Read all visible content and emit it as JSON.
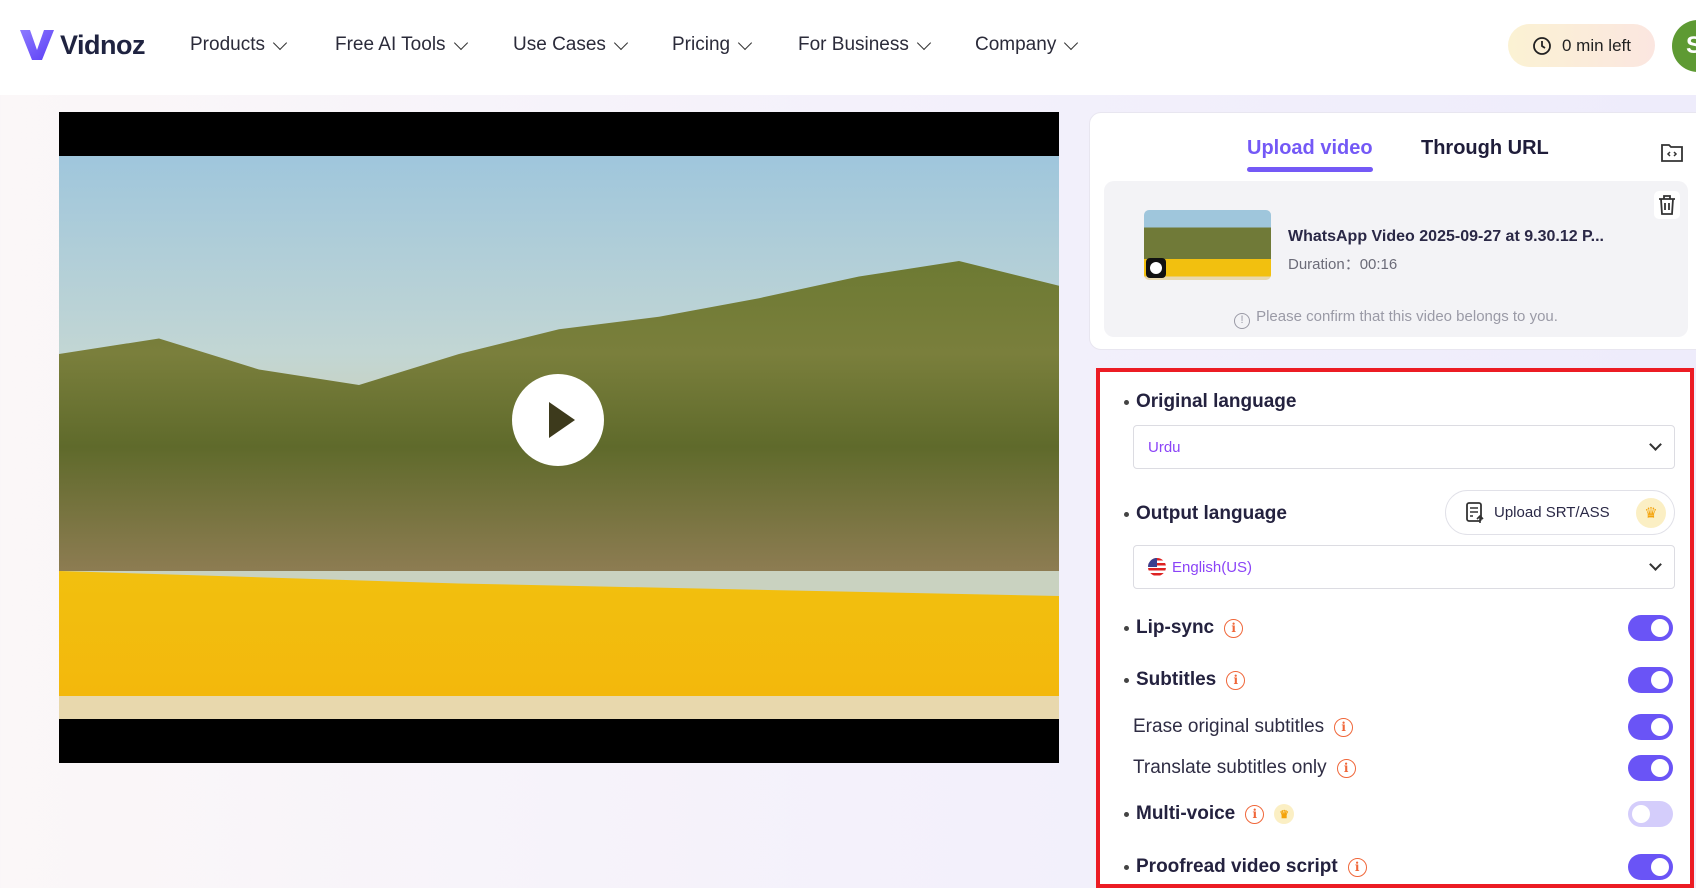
{
  "header": {
    "logo": "Vidnoz",
    "nav": [
      {
        "label": "Products"
      },
      {
        "label": "Free AI Tools"
      },
      {
        "label": "Use Cases"
      },
      {
        "label": "Pricing"
      },
      {
        "label": "For Business"
      },
      {
        "label": "Company"
      }
    ],
    "timer": "0 min left",
    "avatar_initial": "S"
  },
  "upload": {
    "tabs": [
      {
        "label": "Upload video"
      },
      {
        "label": "Through URL"
      }
    ],
    "file_name": "WhatsApp Video 2025-09-27 at 9.30.12 P...",
    "duration": "Duration：00:16",
    "confirm": "Please confirm that this video belongs to you."
  },
  "settings": {
    "original_language_label": "Original language",
    "original_language": "Urdu",
    "output_language_label": "Output language",
    "upload_srt": "Upload SRT/ASS",
    "output_language": "English(US)",
    "lip_sync": {
      "label": "Lip-sync",
      "on": true
    },
    "subtitles": {
      "label": "Subtitles",
      "on": true
    },
    "erase": {
      "label": "Erase original subtitles",
      "on": true
    },
    "translate_only": {
      "label": "Translate subtitles only",
      "on": true
    },
    "multi_voice": {
      "label": "Multi-voice",
      "on": false
    },
    "proofread": {
      "label": "Proofread video script",
      "on": true
    }
  },
  "colors": {
    "accent": "#7459f6",
    "highlight_border": "#ec1c24"
  }
}
